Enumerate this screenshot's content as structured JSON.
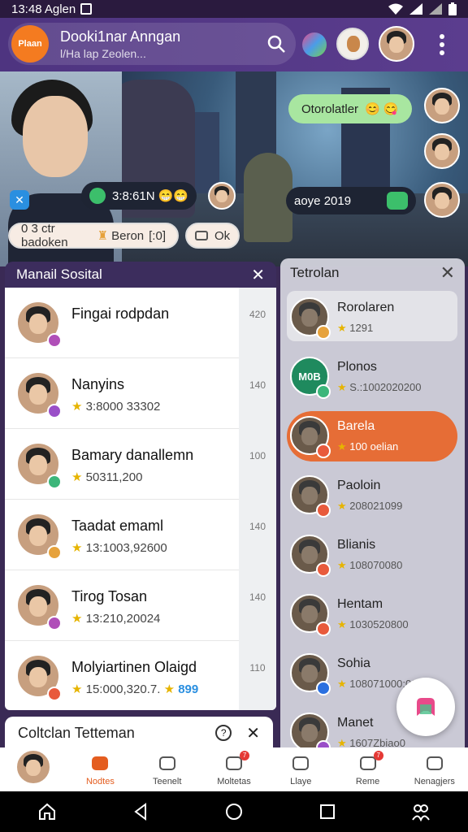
{
  "status_bar": {
    "time": "13:48 Aglen"
  },
  "app_bar": {
    "logo_text": "Plaan",
    "title": "Dooki1nar Anngan",
    "subtitle": "l/Ha lap Zeolen..."
  },
  "hero": {
    "bubble_top": "Otorolatler",
    "chip_left": "3:8:61N",
    "chip_right": "aoye 2019",
    "pill_left": "0 3 ctr badoken",
    "pill_left_tail": "Beron",
    "pill_left_end": "[:0]",
    "pill_right": "Ok"
  },
  "left_panel": {
    "title": "Manail Sosital",
    "items": [
      {
        "name": "Fingai rodpdan",
        "sub": "",
        "num": "420"
      },
      {
        "name": "Nanyins",
        "sub": "3:8000 33302",
        "num": "140"
      },
      {
        "name": "Bamary danallemn",
        "sub": "50311,200",
        "num": "100"
      },
      {
        "name": "Taadat emaml",
        "sub": "13:1003,92600",
        "num": "140"
      },
      {
        "name": "Tirog Tosan",
        "sub": "13:210,20024",
        "num": "140"
      },
      {
        "name": "Molyiartinen Olaigd",
        "sub": "15:000,320.7.",
        "num": "110",
        "tail": "899"
      }
    ]
  },
  "right_panel": {
    "title": "Tetrolan",
    "items": [
      {
        "name": "Rorolaren",
        "sub": "1291"
      },
      {
        "name": "Plonos",
        "sub": "S.:1002020200",
        "avatar_text": "M0B"
      },
      {
        "name": "Barela",
        "sub": "100 oelian"
      },
      {
        "name": "Paoloin",
        "sub": "208021099"
      },
      {
        "name": "Blianis",
        "sub": "108070080"
      },
      {
        "name": "Hentam",
        "sub": "1030520800"
      },
      {
        "name": "Sohia",
        "sub": "108071000:00"
      },
      {
        "name": "Manet",
        "sub": "1607Zbiao0"
      }
    ]
  },
  "bottom_card": {
    "title": "Coltclan Tetteman"
  },
  "bottom_nav": [
    {
      "label": "",
      "name": "profile"
    },
    {
      "label": "Nodtes",
      "name": "home"
    },
    {
      "label": "Teenelt",
      "name": "teenelt"
    },
    {
      "label": "Moltetas",
      "name": "moltetas",
      "badge": "7"
    },
    {
      "label": "Llaye",
      "name": "llaye"
    },
    {
      "label": "Reme",
      "name": "reme",
      "badge": "7"
    },
    {
      "label": "Nenagjers",
      "name": "nenagjers"
    }
  ],
  "colors": {
    "accent": "#e66d36",
    "appbar": "#5b3d8e",
    "logo": "#f47b20"
  }
}
